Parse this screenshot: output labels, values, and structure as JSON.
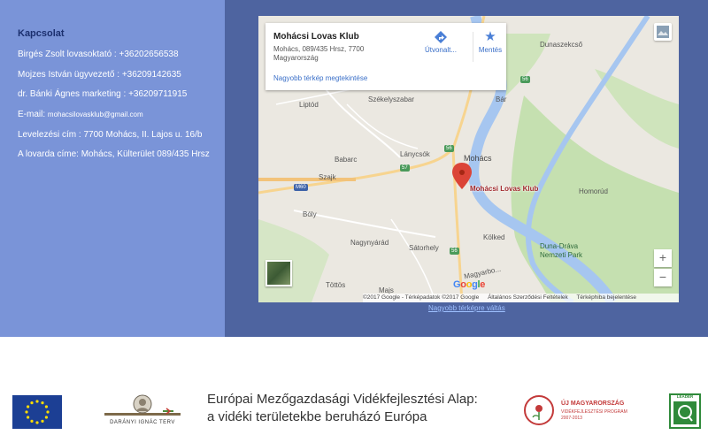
{
  "contact": {
    "title": "Kapcsolat",
    "lines": [
      "Birgés Zsolt lovasoktató : +36202656538",
      "Mojzes István ügyvezető : +36209142635",
      "dr. Bánki Ágnes marketing : +36209711915"
    ],
    "email_label": "E-mail: ",
    "email": "mohacsilovasklub@gmail.com",
    "postal": "Levelezési cím : 7700 Mohács, II. Lajos u. 16/b",
    "address": "A lovarda címe: Mohács, Külterület 089/435 Hrsz"
  },
  "map": {
    "card": {
      "title": "Mohácsi Lovas Klub",
      "address": "Mohács, 089/435 Hrsz, 7700 Magyarország",
      "directions": "Útvonalt...",
      "save": "Mentés",
      "bigger_link": "Nagyobb térkép megtekintése"
    },
    "pin_label": "Mohácsi Lovas Klub",
    "places": {
      "dunaszekcso": "Dunaszekcső",
      "bar": "Bár",
      "szekelyszabar": "Székelyszabar",
      "liptod": "Liptód",
      "lanycsok": "Lánycsók",
      "mohacs": "Mohács",
      "babarc": "Babarc",
      "szajk": "Szajk",
      "homorud": "Homorúd",
      "boly": "Bóly",
      "nagynyarad": "Nagynyárád",
      "satorhely": "Sátorhely",
      "kolked": "Kölked",
      "duna_drava": "Duna-Dráva Nemzeti Park",
      "magyarbo": "Magyarbo...",
      "tottos": "Töttös",
      "majs": "Majs"
    },
    "shields": {
      "r56a": "56",
      "r56b": "56",
      "r56c": "56",
      "r57": "57",
      "m60": "M60"
    },
    "google": "Google",
    "attribution": {
      "data": "©2017 Google - Térképadatok ©2017 Google",
      "terms": "Általános Szerződési Feltételek",
      "report": "Térképhiba bejelentése"
    },
    "zoom_in": "+",
    "zoom_out": "−",
    "bigger_map_link": "Nagyobb térképre váltás"
  },
  "footer": {
    "darany": "DARÁNYI IGNÁC TERV",
    "fund_line1": "Európai Mezőgazdasági Vidékfejlesztési Alap:",
    "fund_line2": "a vidéki területekbe beruházó Európa",
    "uj_title": "ÚJ MAGYARORSZÁG",
    "uj_sub": "VIDÉKFEJLESZTÉSI PROGRAM",
    "uj_years": "2007-2013",
    "leader": "LEADER"
  },
  "colors": {
    "contact_bg": "#7a94d8",
    "map_bg": "#4e64a0",
    "title_blue": "#1b2f6e",
    "river": "#a6c6f0",
    "pin_red": "#db4437"
  }
}
